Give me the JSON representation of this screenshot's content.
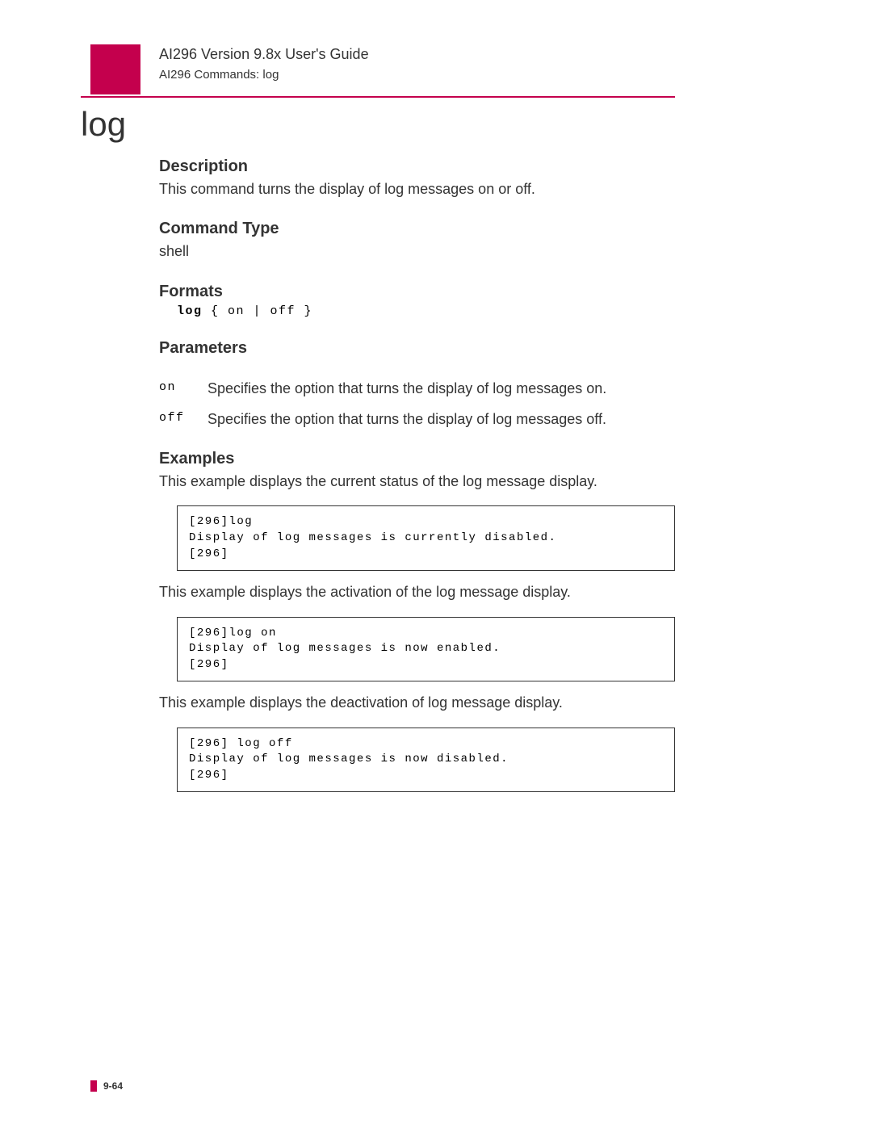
{
  "header": {
    "title": "AI296 Version 9.8x User's Guide",
    "subtitle": "AI296 Commands: log"
  },
  "main_heading": "log",
  "sections": {
    "description": {
      "heading": "Description",
      "text": "This command turns the display of log messages on or off."
    },
    "command_type": {
      "heading": "Command Type",
      "text": "shell"
    },
    "formats": {
      "heading": "Formats",
      "code_cmd": "log",
      "code_args": " { on | off }"
    },
    "parameters": {
      "heading": "Parameters",
      "rows": [
        {
          "name": "on",
          "desc": "Specifies the option that turns the display of log messages on."
        },
        {
          "name": "off",
          "desc": "Specifies the option that turns the display of log messages off."
        }
      ]
    },
    "examples": {
      "heading": "Examples",
      "items": [
        {
          "intro": "This example displays the current status of the log message display.",
          "code": "[296]log\nDisplay of log messages is currently disabled.\n[296]"
        },
        {
          "intro": "This example displays the activation of the log message display.",
          "code": "[296]log on\nDisplay of log messages is now enabled.\n[296]"
        },
        {
          "intro": "This example displays the deactivation of log message display.",
          "code": "[296] log off\nDisplay of log messages is now disabled.\n[296]"
        }
      ]
    }
  },
  "footer": {
    "page": "9-64"
  }
}
